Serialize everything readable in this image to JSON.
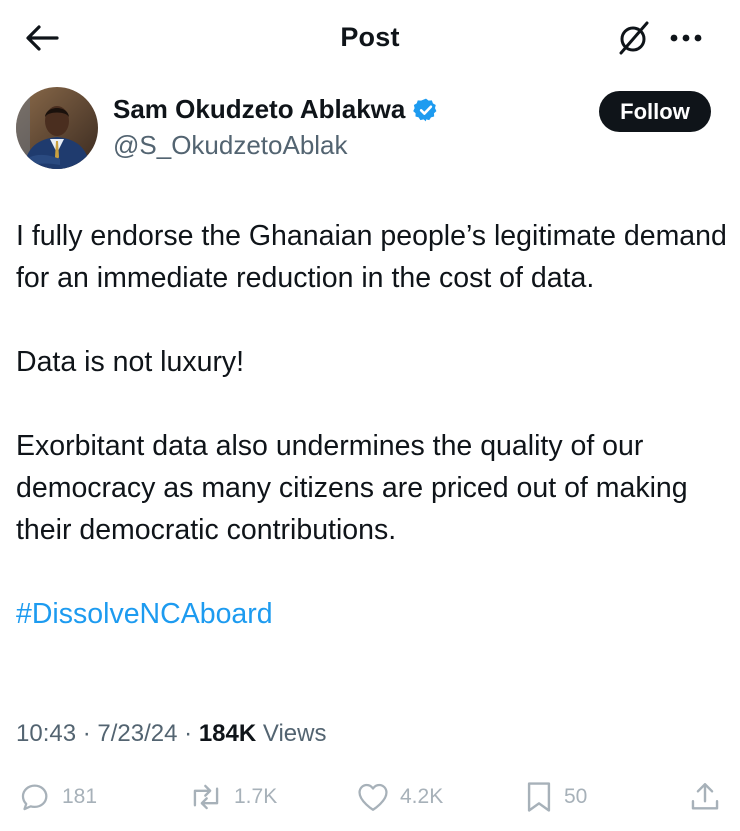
{
  "header": {
    "title": "Post"
  },
  "author": {
    "display_name": "Sam Okudzeto Ablakwa",
    "handle": "@S_OkudzetoAblak",
    "follow_label": "Follow"
  },
  "tweet": {
    "paragraphs": [
      "I fully endorse the Ghanaian people’s legitimate demand for an immediate reduction in the cost of data.",
      "Data is not luxury!",
      "Exorbitant data also undermines the quality of our democracy as many citizens are priced out of making their democratic contributions."
    ],
    "hashtag": "#DissolveNCAboard"
  },
  "meta": {
    "time": "10:43",
    "date": "7/23/24",
    "views_count": "184K",
    "views_label": "Views"
  },
  "actions": {
    "replies": "181",
    "reposts": "1.7K",
    "likes": "4.2K",
    "bookmarks": "50"
  },
  "colors": {
    "hashtag": "#1d9bf0",
    "verified": "#1d9bf0",
    "text": "#0f1419",
    "secondary": "#536471",
    "action_muted": "#a7b1b9"
  }
}
